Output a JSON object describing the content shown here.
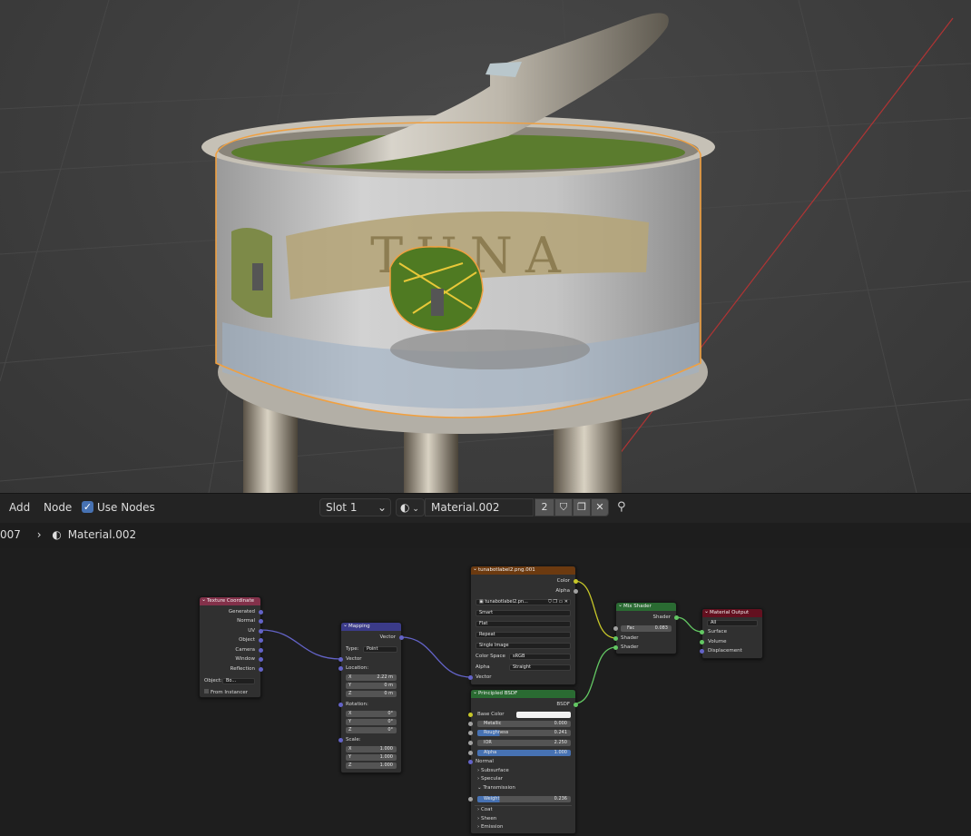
{
  "header": {
    "add_label": "Add",
    "node_label": "Node",
    "use_nodes_label": "Use Nodes",
    "slot_value": "Slot 1",
    "material_name": "Material.002",
    "user_count": "2"
  },
  "breadcrumb": {
    "object": "007",
    "material": "Material.002"
  },
  "nodes": {
    "texcoord": {
      "title": "Texture Coordinate",
      "outputs": [
        "Generated",
        "Normal",
        "UV",
        "Object",
        "Camera",
        "Window",
        "Reflection"
      ],
      "object_label": "Object:",
      "object_value": "Bo...",
      "from_instancer": "From Instancer"
    },
    "mapping": {
      "title": "Mapping",
      "out": "Vector",
      "type_label": "Type:",
      "type_value": "Point",
      "vector_in": "Vector",
      "location_label": "Location:",
      "location": [
        {
          "axis": "X",
          "value": "2.22 m"
        },
        {
          "axis": "Y",
          "value": "0 m"
        },
        {
          "axis": "Z",
          "value": "0 m"
        }
      ],
      "rotation_label": "Rotation:",
      "rotation": [
        {
          "axis": "X",
          "value": "0°"
        },
        {
          "axis": "Y",
          "value": "0°"
        },
        {
          "axis": "Z",
          "value": "0°"
        }
      ],
      "scale_label": "Scale:",
      "scale": [
        {
          "axis": "X",
          "value": "1.000"
        },
        {
          "axis": "Y",
          "value": "1.000"
        },
        {
          "axis": "Z",
          "value": "1.000"
        }
      ]
    },
    "image": {
      "title": "tunabotlabel2.png.001",
      "out_color": "Color",
      "out_alpha": "Alpha",
      "image_name": "tunabotlabel2.pn...",
      "interpolation": "Smart",
      "projection": "Flat",
      "extension": "Repeat",
      "source": "Single Image",
      "colorspace_label": "Color Space",
      "colorspace_value": "sRGB",
      "alpha_label": "Alpha",
      "alpha_value": "Straight",
      "vector_in": "Vector"
    },
    "bsdf": {
      "title": "Principled BSDF",
      "out": "BSDF",
      "base_color": "Base Color",
      "metallic_label": "Metallic",
      "metallic_value": "0.000",
      "roughness_label": "Roughness",
      "roughness_value": "0.241",
      "ior_label": "IOR",
      "ior_value": "2.250",
      "alpha_label": "Alpha",
      "alpha_value": "1.000",
      "normal": "Normal",
      "subsurface": "Subsurface",
      "specular": "Specular",
      "transmission": "Transmission",
      "weight_label": "Weight",
      "weight_value": "0.236",
      "coat": "Coat",
      "sheen": "Sheen",
      "emission": "Emission"
    },
    "mix": {
      "title": "Mix Shader",
      "out": "Shader",
      "fac_label": "Fac",
      "fac_value": "0.083",
      "shader1": "Shader",
      "shader2": "Shader"
    },
    "output": {
      "title": "Material Output",
      "target": "All",
      "surface": "Surface",
      "volume": "Volume",
      "displacement": "Displacement"
    }
  },
  "colors": {
    "accent": "#4772b3",
    "selection_outline": "#f0a040",
    "texcoord_header": "#83314a",
    "mapping_header": "#3b3b89",
    "image_header": "#6c3a10",
    "shader_header": "#2a6b32",
    "output_header": "#63101f"
  }
}
